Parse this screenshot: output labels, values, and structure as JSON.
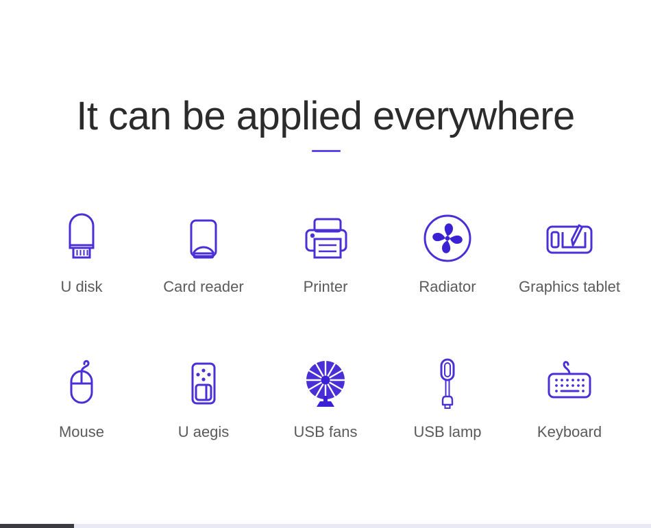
{
  "header": {
    "title": "It can be applied everywhere",
    "divider_color": "#5b46e8"
  },
  "theme": {
    "accent": "#4a2fd6",
    "title_color": "#2b2b2b",
    "label_color": "#5a5a5a",
    "background": "#ffffff"
  },
  "grid": {
    "rows": [
      {
        "items": [
          {
            "label": "U disk",
            "icon": "usb-flash-drive-icon"
          },
          {
            "label": "Card reader",
            "icon": "card-reader-icon"
          },
          {
            "label": "Printer",
            "icon": "printer-icon"
          },
          {
            "label": "Radiator",
            "icon": "radiator-fan-icon"
          },
          {
            "label": "Graphics tablet",
            "icon": "graphics-tablet-icon"
          }
        ]
      },
      {
        "items": [
          {
            "label": "Mouse",
            "icon": "mouse-icon"
          },
          {
            "label": "U aegis",
            "icon": "u-aegis-icon"
          },
          {
            "label": "USB fans",
            "icon": "usb-fan-icon"
          },
          {
            "label": "USB lamp",
            "icon": "usb-lamp-icon"
          },
          {
            "label": "Keyboard",
            "icon": "keyboard-icon"
          }
        ]
      }
    ]
  },
  "scrollbar": {
    "orientation": "horizontal",
    "thumb_color": "#3b3b41",
    "track_color": "#e8e9f5"
  }
}
